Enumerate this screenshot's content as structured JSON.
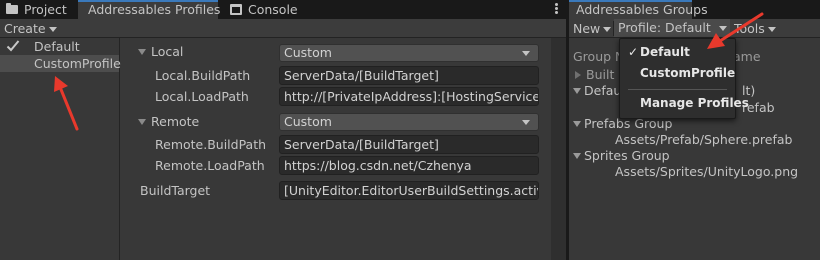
{
  "left_tabs": {
    "project": "Project",
    "profiles": "Addressables Profiles",
    "console": "Console"
  },
  "left_toolbar": {
    "create": "Create"
  },
  "profiles": [
    {
      "label": "Default",
      "checked": true,
      "selected": false
    },
    {
      "label": "CustomProfile",
      "checked": false,
      "selected": true
    }
  ],
  "settings": {
    "local": {
      "header": "Local",
      "mode": "Custom",
      "build_path_label": "Local.BuildPath",
      "build_path_value": "ServerData/[BuildTarget]",
      "load_path_label": "Local.LoadPath",
      "load_path_value": "http://[PrivateIpAddress]:[HostingServicePort]"
    },
    "remote": {
      "header": "Remote",
      "mode": "Custom",
      "build_path_label": "Remote.BuildPath",
      "build_path_value": "ServerData/[BuildTarget]",
      "load_path_label": "Remote.LoadPath",
      "load_path_value": "https://blog.csdn.net/Czhenya"
    },
    "build_target_label": "BuildTarget",
    "build_target_value": "[UnityEditor.EditorUserBuildSettings.activeBuildTarget]"
  },
  "right_tab": {
    "title": "Addressables Groups"
  },
  "right_toolbar": {
    "new": "New",
    "profile": "Profile: Default",
    "tools": "Tools"
  },
  "tree": {
    "header_left": "Group N",
    "header_right": "ame",
    "rows": [
      {
        "text": "Built I",
        "suffix": "",
        "state": "closed"
      },
      {
        "text": "Defau",
        "suffix": "lt)",
        "state": "open"
      },
      {
        "text": "",
        "suffix": "refab",
        "state": "child"
      },
      {
        "text": "Prefabs Group",
        "suffix": "",
        "state": "open"
      },
      {
        "text": "Assets/Prefab/Sphere.prefab",
        "suffix": "",
        "state": "child"
      },
      {
        "text": "Sprites Group",
        "suffix": "",
        "state": "open"
      },
      {
        "text": "Assets/Sprites/UnityLogo.png",
        "suffix": "",
        "state": "child"
      }
    ]
  },
  "profile_menu": {
    "items": [
      {
        "label": "Default",
        "checked": true
      },
      {
        "label": "CustomProfile",
        "checked": false
      },
      {
        "label": "Manage Profiles",
        "checked": false
      }
    ],
    "check_mark": "✓"
  },
  "colors": {
    "accent_tab": "#3a79bb",
    "annotation_arrow": "#e8392c"
  }
}
